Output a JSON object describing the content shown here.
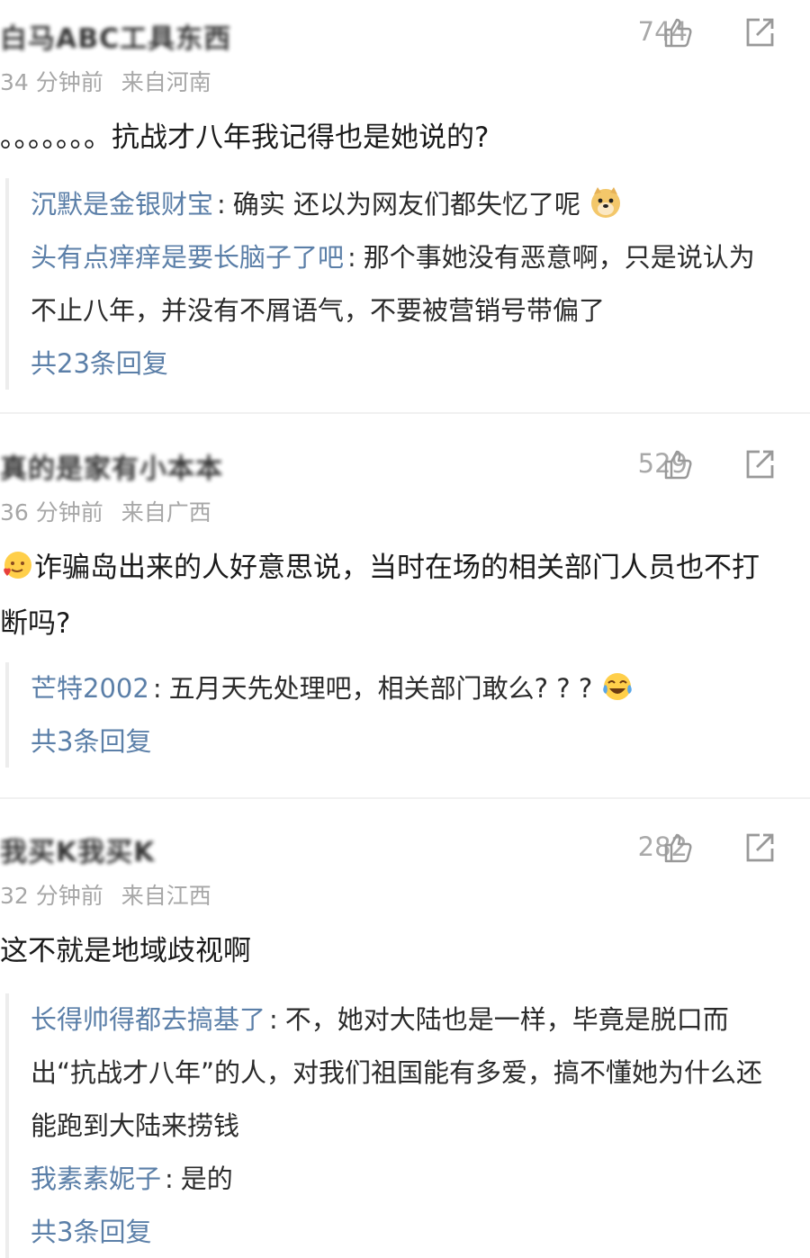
{
  "comments": [
    {
      "author": "白马ABC工具东西",
      "time": "34 分钟前",
      "location": "来自河南",
      "likes": "744",
      "text": "。。。。。。。抗战才八年我记得也是她说的?",
      "replies": [
        {
          "name": "沉默是金银财宝",
          "text": "确实 还以为网友们都失忆了呢",
          "emoji": "doge-emoji"
        },
        {
          "name": "头有点痒痒是要长脑子了吧",
          "text": "那个事她没有恶意啊，只是说认为不止八年，并没有不屑语气，不要被营销号带偏了"
        }
      ],
      "more": "共23条回复"
    },
    {
      "author": "真的是家有小本本",
      "time": "36 分钟前",
      "location": "来自广西",
      "likes": "529",
      "text": "诈骗岛出来的人好意思说，当时在场的相关部门人员也不打断吗?",
      "text_emoji": "heart-eyes-emoji",
      "replies": [
        {
          "name": "芒特2002",
          "text": "五月天先处理吧，相关部门敢么? ? ?",
          "emoji": "laugh-cry-emoji"
        }
      ],
      "more": "共3条回复"
    },
    {
      "author": "我买K我买K",
      "time": "32 分钟前",
      "location": "来自江西",
      "likes": "282",
      "text": "这不就是地域歧视啊",
      "replies": [
        {
          "name": "长得帅得都去搞基了",
          "text": "不，她对大陆也是一样，毕竟是脱口而出“抗战才八年”的人，对我们祖国能有多爱，搞不懂她为什么还能跑到大陆来捞钱"
        },
        {
          "name": "我素素妮子",
          "text": "是的"
        }
      ],
      "more": "共3条回复"
    }
  ],
  "colors": {
    "reply_name": "#5b7fa8",
    "meta": "#a7a7a7",
    "divider": "#f1f1f1"
  }
}
